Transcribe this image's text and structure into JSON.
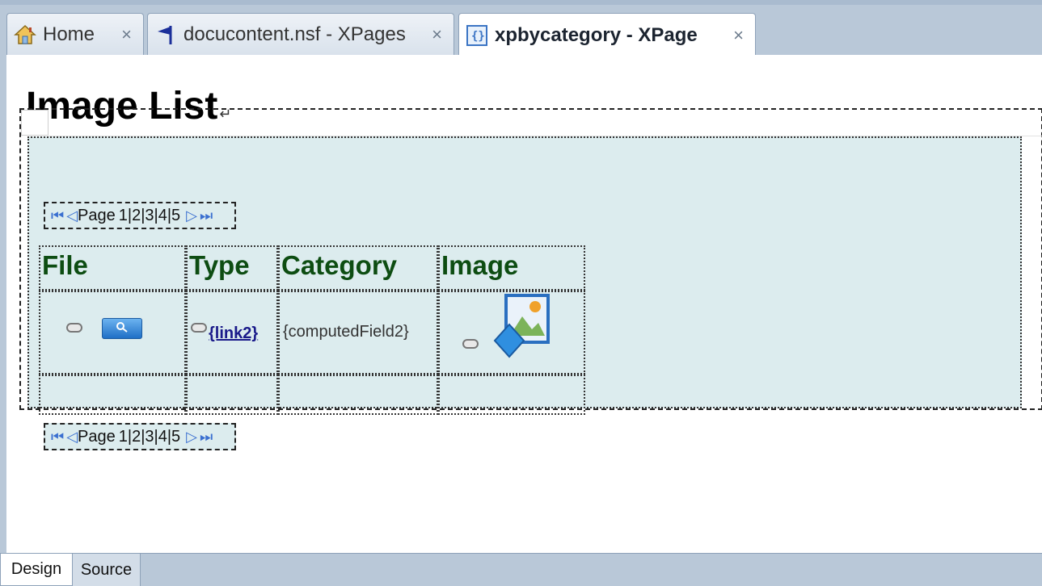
{
  "tabs": [
    {
      "label": "Home",
      "icon": "home-icon",
      "close": "×",
      "active": false
    },
    {
      "label": "docucontent.nsf - XPages",
      "icon": "flag-icon",
      "close": "×",
      "active": false
    },
    {
      "label": "xpbycategory - XPage",
      "icon": "xpage-icon",
      "close": "×",
      "active": true
    }
  ],
  "canvas": {
    "title": "Image List",
    "title_marker": "↵"
  },
  "pager": {
    "first_icon": "first-page-icon",
    "prev_icon": "previous-page-icon",
    "label": "Page",
    "pages": "1|2|3|4|5",
    "next_icon": "next-page-icon",
    "last_icon": "last-page-icon"
  },
  "table": {
    "headers": [
      "File",
      "Type",
      "Category",
      "Image"
    ],
    "row": {
      "type_link": "{link2}",
      "category_value": "{computedField2}"
    }
  },
  "bottom_tabs": [
    {
      "label": "Design",
      "active": true
    },
    {
      "label": "Source",
      "active": false
    }
  ],
  "colors": {
    "header_text": "#0d4d12",
    "view_background": "#dcecee",
    "chrome": "#b9c8d8"
  }
}
